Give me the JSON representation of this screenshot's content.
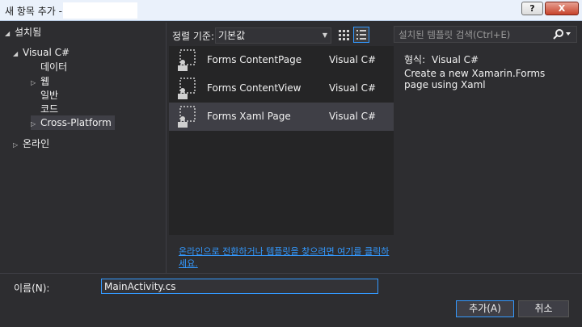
{
  "window": {
    "title": "새 항목 추가 -",
    "help_label": "?",
    "close_label": "X"
  },
  "left_panel": {
    "installed": "설치됨",
    "visual_csharp": "Visual C#",
    "data": "데이터",
    "web": "웹",
    "general": "일반",
    "code": "코드",
    "cross_platform": "Cross-Platform",
    "online": "온라인"
  },
  "toolbar": {
    "sort_label": "정렬 기준:",
    "sort_value": "기본값"
  },
  "templates": [
    {
      "name": "Forms ContentPage",
      "lang": "Visual C#"
    },
    {
      "name": "Forms ContentView",
      "lang": "Visual C#"
    },
    {
      "name": "Forms Xaml Page",
      "lang": "Visual C#"
    }
  ],
  "online_link": "온라인으로 전환하거나 템플릿을 찾으려면 여기를 클릭하세요.",
  "search": {
    "placeholder": "설치된 템플릿 검색(Ctrl+E)"
  },
  "details": {
    "type_label": "형식:",
    "type_value": "Visual C#",
    "description": "Create a new Xamarin.Forms page using Xaml"
  },
  "footer": {
    "name_label": "이름(N):",
    "name_value": "MainActivity.cs",
    "add_button": "추가(A)",
    "cancel_button": "취소"
  },
  "colors": {
    "background": "#2d2d30",
    "accent": "#3399ff",
    "selection": "#3f3f46"
  }
}
